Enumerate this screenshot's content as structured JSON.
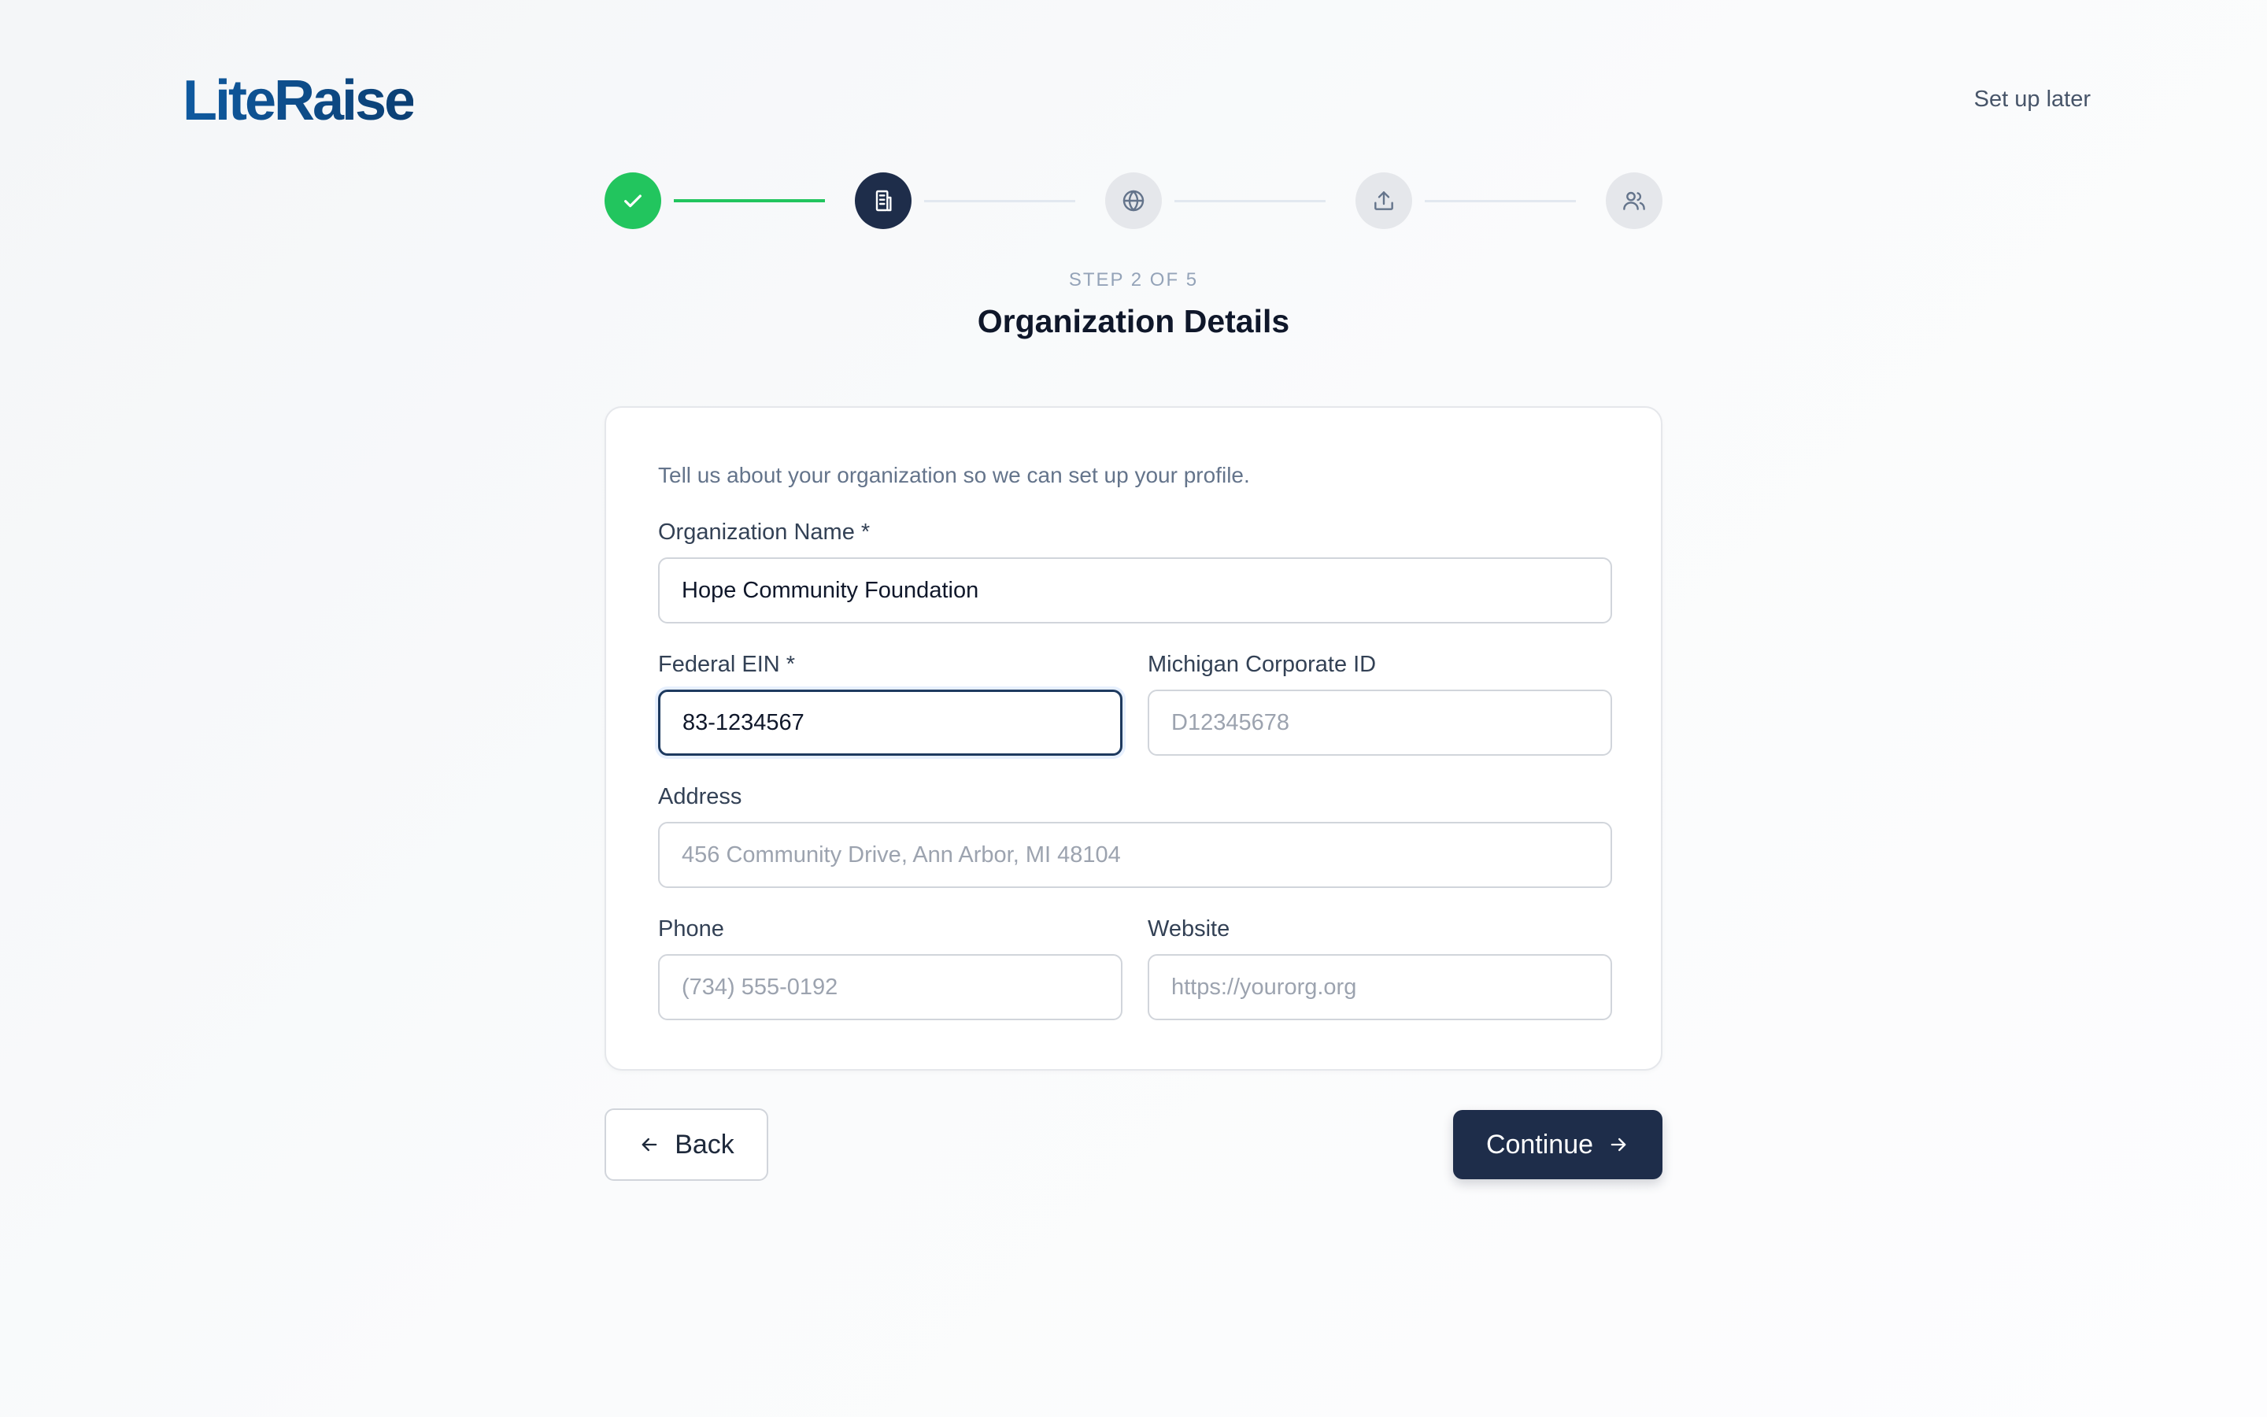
{
  "brand": {
    "logo_text": "LiteRaise",
    "accent": "#0f5aa0"
  },
  "header": {
    "setup_later": "Set up later"
  },
  "stepper": {
    "current": 2,
    "total": 5,
    "steps": [
      {
        "icon": "check-icon",
        "status": "done"
      },
      {
        "icon": "building-icon",
        "status": "active"
      },
      {
        "icon": "globe-icon",
        "status": "pending"
      },
      {
        "icon": "upload-icon",
        "status": "pending"
      },
      {
        "icon": "users-icon",
        "status": "pending"
      }
    ],
    "colors": {
      "done": "#22c55e",
      "active": "#1e2d4a",
      "pending": "#e5e7eb"
    }
  },
  "step_count_label": "STEP 2 OF 5",
  "title": "Organization Details",
  "form": {
    "intro": "Tell us about your organization so we can set up your profile.",
    "org_name": {
      "label": "Organization Name *",
      "value": "Hope Community Foundation",
      "placeholder": ""
    },
    "ein": {
      "label": "Federal EIN *",
      "value": "83-1234567",
      "placeholder": ""
    },
    "corporate_id": {
      "label": "Michigan Corporate ID",
      "value": "",
      "placeholder": "D12345678"
    },
    "address": {
      "label": "Address",
      "value": "",
      "placeholder": "456 Community Drive, Ann Arbor, MI 48104"
    },
    "phone": {
      "label": "Phone",
      "value": "",
      "placeholder": "(734) 555-0192"
    },
    "website": {
      "label": "Website",
      "value": "",
      "placeholder": "https://yourorg.org"
    }
  },
  "actions": {
    "back": "Back",
    "continue": "Continue"
  }
}
